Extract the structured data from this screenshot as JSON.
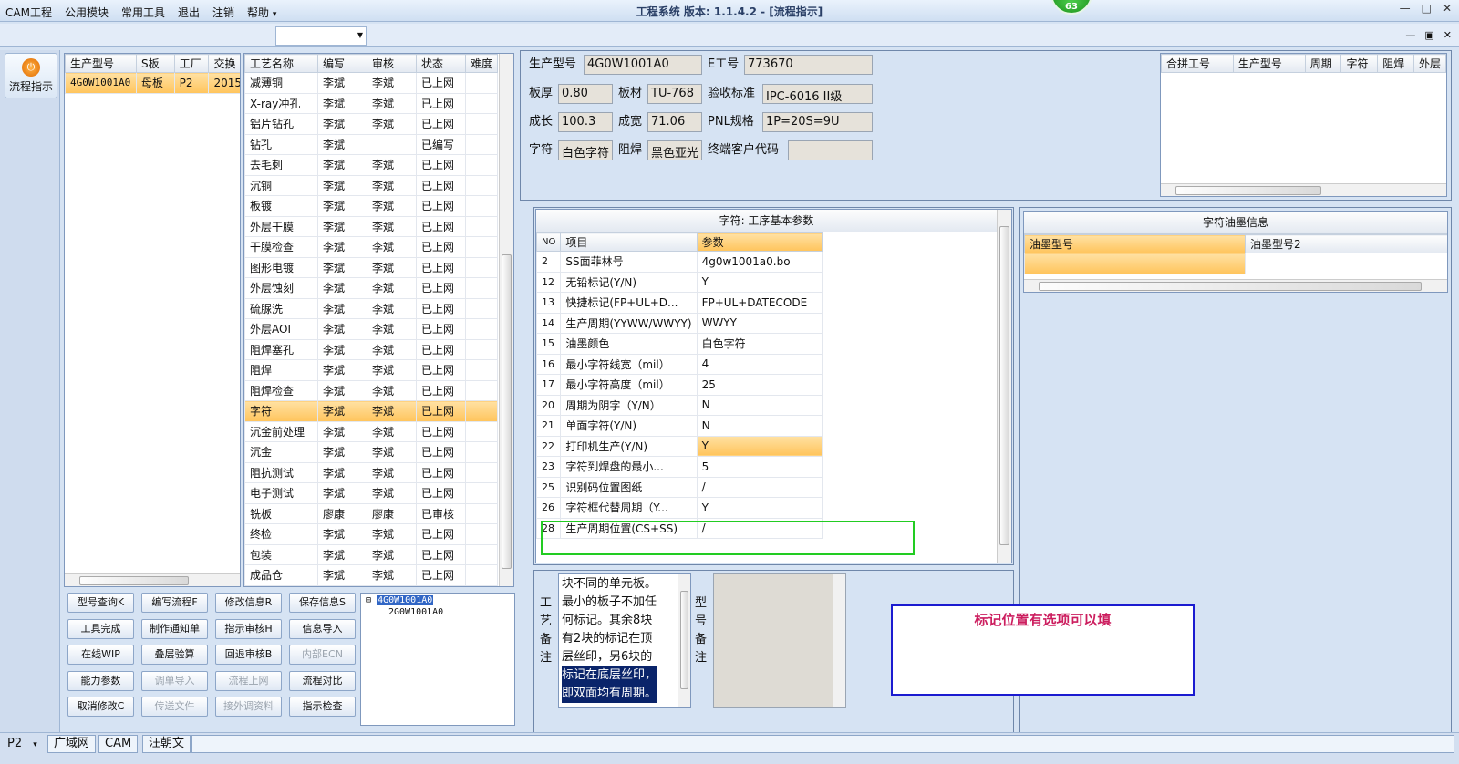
{
  "window": {
    "title": "工程系统  版本: 1.1.4.2 - [流程指示]",
    "badge": "63",
    "min": "—",
    "max": "□",
    "close": "✕"
  },
  "menu": {
    "items": [
      "CAM工程",
      "公用模块",
      "常用工具",
      "退出",
      "注销",
      "帮助"
    ],
    "help_arrow": "▾",
    "combo_value": ""
  },
  "mdi": {
    "min": "—",
    "restore": "▣",
    "close": "✕"
  },
  "left_nav": {
    "flow_button": "流程指示"
  },
  "product_list": {
    "headers": [
      "生产型号",
      "S板",
      "工厂",
      "交换"
    ],
    "rows": [
      [
        "4G0W1001A0",
        "母板",
        "P2",
        "2015"
      ]
    ]
  },
  "process_list": {
    "headers": [
      "工艺名称",
      "编写",
      "审核",
      "状态",
      "难度"
    ],
    "rows": [
      [
        "减薄铜",
        "李斌",
        "李斌",
        "已上网",
        ""
      ],
      [
        "X-ray冲孔",
        "李斌",
        "李斌",
        "已上网",
        ""
      ],
      [
        "铝片钻孔",
        "李斌",
        "李斌",
        "已上网",
        ""
      ],
      [
        "钻孔",
        "李斌",
        "",
        "已编写",
        ""
      ],
      [
        "去毛刺",
        "李斌",
        "李斌",
        "已上网",
        ""
      ],
      [
        "沉铜",
        "李斌",
        "李斌",
        "已上网",
        ""
      ],
      [
        "板镀",
        "李斌",
        "李斌",
        "已上网",
        ""
      ],
      [
        "外层干膜",
        "李斌",
        "李斌",
        "已上网",
        ""
      ],
      [
        "干膜检查",
        "李斌",
        "李斌",
        "已上网",
        ""
      ],
      [
        "图形电镀",
        "李斌",
        "李斌",
        "已上网",
        ""
      ],
      [
        "外层蚀刻",
        "李斌",
        "李斌",
        "已上网",
        ""
      ],
      [
        "硫脲洗",
        "李斌",
        "李斌",
        "已上网",
        ""
      ],
      [
        "外层AOI",
        "李斌",
        "李斌",
        "已上网",
        ""
      ],
      [
        "阻焊塞孔",
        "李斌",
        "李斌",
        "已上网",
        ""
      ],
      [
        "阻焊",
        "李斌",
        "李斌",
        "已上网",
        ""
      ],
      [
        "阻焊检查",
        "李斌",
        "李斌",
        "已上网",
        ""
      ],
      [
        "字符",
        "李斌",
        "李斌",
        "已上网",
        ""
      ],
      [
        "沉金前处理",
        "李斌",
        "李斌",
        "已上网",
        ""
      ],
      [
        "沉金",
        "李斌",
        "李斌",
        "已上网",
        ""
      ],
      [
        "阻抗测试",
        "李斌",
        "李斌",
        "已上网",
        ""
      ],
      [
        "电子测试",
        "李斌",
        "李斌",
        "已上网",
        ""
      ],
      [
        "铣板",
        "廖康",
        "廖康",
        "已审核",
        ""
      ],
      [
        "终检",
        "李斌",
        "李斌",
        "已上网",
        ""
      ],
      [
        "包装",
        "李斌",
        "李斌",
        "已上网",
        ""
      ],
      [
        "成品仓",
        "李斌",
        "李斌",
        "已上网",
        ""
      ]
    ],
    "selected_index": 16
  },
  "buttons": [
    [
      "型号查询K",
      "编写流程F",
      "修改信息R",
      "保存信息S"
    ],
    [
      "工具完成",
      "制作通知单",
      "指示审核H",
      "信息导入"
    ],
    [
      "在线WIP",
      "叠层验算",
      "回退审核B",
      "内部ECN"
    ],
    [
      "能力参数",
      "调单导入",
      "流程上网",
      "流程对比"
    ],
    [
      "取消修改C",
      "传送文件",
      "接外调资料",
      "指示检查"
    ]
  ],
  "tree": {
    "root": "4G0W1001A0",
    "child": "2G0W1001A0",
    "expander": "⊟"
  },
  "info": {
    "prod_model_label": "生产型号",
    "prod_model": "4G0W1001A0",
    "e_no_label": "E工号",
    "e_no": "773670",
    "thickness_label": "板厚",
    "thickness": "0.80",
    "material_label": "板材",
    "material": "TU-768",
    "standard_label": "验收标准",
    "standard": "IPC-6016 II级",
    "length_label": "成长",
    "length": "100.3",
    "width_label": "成宽",
    "width": "71.06",
    "pnl_label": "PNL规格",
    "pnl": "1P=20S=9U",
    "char_label": "字符",
    "char": "白色字符",
    "mask_label": "阻焊",
    "mask": "黑色亚光",
    "customer_label": "终端客户代码",
    "customer": ""
  },
  "merge_table": {
    "headers": [
      "合拼工号",
      "生产型号",
      "周期",
      "字符",
      "阻焊",
      "外层"
    ]
  },
  "params": {
    "title": "字符: 工序基本参数",
    "headers": [
      "NO",
      "项目",
      "参数"
    ],
    "rows": [
      [
        "2",
        "SS面菲林号",
        "4g0w1001a0.bo"
      ],
      [
        "12",
        "无铅标记(Y/N)",
        "Y"
      ],
      [
        "13",
        "快捷标记(FP+UL+D...",
        "FP+UL+DATECODE"
      ],
      [
        "14",
        "生产周期(YYWW/WWYY)",
        "WWYY"
      ],
      [
        "15",
        "油墨颜色",
        "白色字符"
      ],
      [
        "16",
        "最小字符线宽（mil）",
        "4"
      ],
      [
        "17",
        "最小字符高度（mil）",
        "25"
      ],
      [
        "20",
        "周期为阴字（Y/N）",
        "N"
      ],
      [
        "21",
        "单面字符(Y/N)",
        "N"
      ],
      [
        "22",
        "打印机生产(Y/N)",
        "Y"
      ],
      [
        "23",
        "字符到焊盘的最小...",
        "5"
      ],
      [
        "25",
        "识别码位置图纸",
        "/"
      ],
      [
        "26",
        "字符框代替周期（Y...",
        "Y"
      ],
      [
        "28",
        "生产周期位置(CS+SS)",
        "/"
      ]
    ],
    "selected_index": 9
  },
  "ink": {
    "title": "字符油墨信息",
    "headers": [
      "油墨型号",
      "油墨型号2"
    ]
  },
  "process_note": {
    "label": "工艺备注",
    "lines": [
      "块不同的单元板。",
      "最小的板子不加任",
      "何标记。其余8块",
      "有2块的标记在顶",
      "层丝印，另6块的",
      "标记在底层丝印，",
      "即双面均有周期。"
    ]
  },
  "model_note": {
    "label": "型号备注"
  },
  "annotation": "标记位置有选项可以填",
  "status": {
    "site": "P2",
    "arrow": "▾",
    "tabs": [
      "广域网",
      "CAM",
      "汪朝文"
    ]
  },
  "colors": {
    "selected_row": "#ffc45c",
    "highlight_box": "#22cc22",
    "note_box": "#1b1bd0",
    "note_text": "#cc1d5e"
  }
}
